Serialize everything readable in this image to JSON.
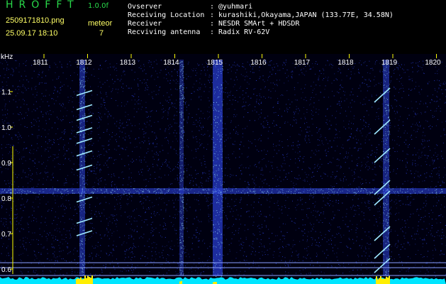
{
  "header": {
    "app_title": "HROFFT",
    "version": "1.0.0f",
    "filename": "2509171810.png",
    "datetime": "25.09.17 18:10",
    "meteor_label": "meteor",
    "meteor_count": "7",
    "info": [
      {
        "label": "Ovserver",
        "value": ": @yuhmari"
      },
      {
        "label": "Receiving Location",
        "value": ": kurashiki,Okayama,JAPAN (133.77E, 34.58N)"
      },
      {
        "label": "Receiver",
        "value": ": NESDR SMArt + HDSDR"
      },
      {
        "label": "Recviving antenna",
        "value": ": Radix RV-62V"
      }
    ]
  },
  "axes": {
    "y_unit": "kHz",
    "y_ticks": [
      "1.1",
      "1.0",
      "0.9",
      "0.8",
      "0.7",
      "0.6"
    ],
    "y_values": [
      1.1,
      1.0,
      0.9,
      0.8,
      0.7,
      0.6
    ],
    "x_ticks": [
      "1811",
      "1812",
      "1813",
      "1814",
      "1815",
      "1816",
      "1817",
      "1818",
      "1819",
      "1820"
    ]
  },
  "colors": {
    "background": "#000010",
    "noise": "#2a3fd8",
    "signal": "#9fe8ff",
    "level": "#00e5ff",
    "peak": "#ffee00",
    "tick": "#ffff00",
    "title": "#29d94a"
  }
}
